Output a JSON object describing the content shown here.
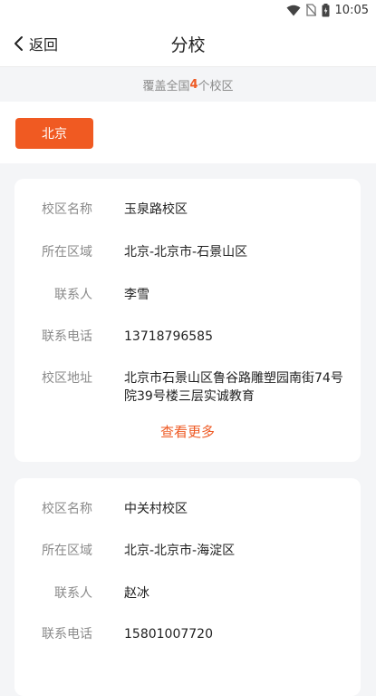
{
  "status_bar": {
    "time": "10:05",
    "icons": [
      "wifi-icon",
      "no-sim-icon",
      "battery-icon"
    ]
  },
  "nav": {
    "back_label": "返回",
    "title": "分校"
  },
  "coverage": {
    "prefix": "覆盖全国",
    "count": "4",
    "suffix": "个校区"
  },
  "city_tabs": [
    {
      "label": "北京",
      "selected": true
    }
  ],
  "labels": {
    "name": "校区名称",
    "region": "所在区域",
    "contact": "联系人",
    "phone": "联系电话",
    "address": "校区地址"
  },
  "campuses": [
    {
      "name": "玉泉路校区",
      "region": "北京-北京市-石景山区",
      "contact": "李雪",
      "phone": "13718796585",
      "address": "北京市石景山区鲁谷路雕塑园南街74号院39号楼三层实诚教育",
      "more_label": "查看更多"
    },
    {
      "name": "中关村校区",
      "region": "北京-北京市-海淀区",
      "contact": "赵冰",
      "phone": "15801007720"
    }
  ],
  "colors": {
    "accent": "#f05a22",
    "accent_text": "#ee5a24",
    "background": "#f4f5f7"
  }
}
